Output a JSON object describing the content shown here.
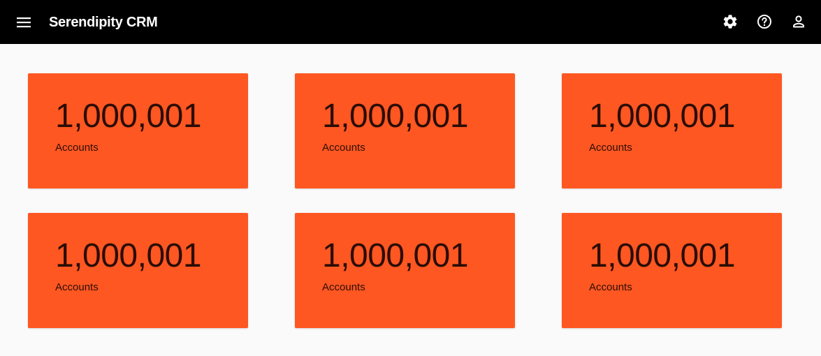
{
  "app": {
    "title": "Serendipity CRM",
    "accent_color": "#ff5722",
    "header_color": "#000000"
  },
  "toolbar": {
    "menu_icon": "menu-icon",
    "settings_icon": "settings-gear-icon",
    "help_icon": "help-icon",
    "account_icon": "account-icon"
  },
  "cards": [
    {
      "value": "1,000,001",
      "label": "Accounts"
    },
    {
      "value": "1,000,001",
      "label": "Accounts"
    },
    {
      "value": "1,000,001",
      "label": "Accounts"
    },
    {
      "value": "1,000,001",
      "label": "Accounts"
    },
    {
      "value": "1,000,001",
      "label": "Accounts"
    },
    {
      "value": "1,000,001",
      "label": "Accounts"
    }
  ]
}
